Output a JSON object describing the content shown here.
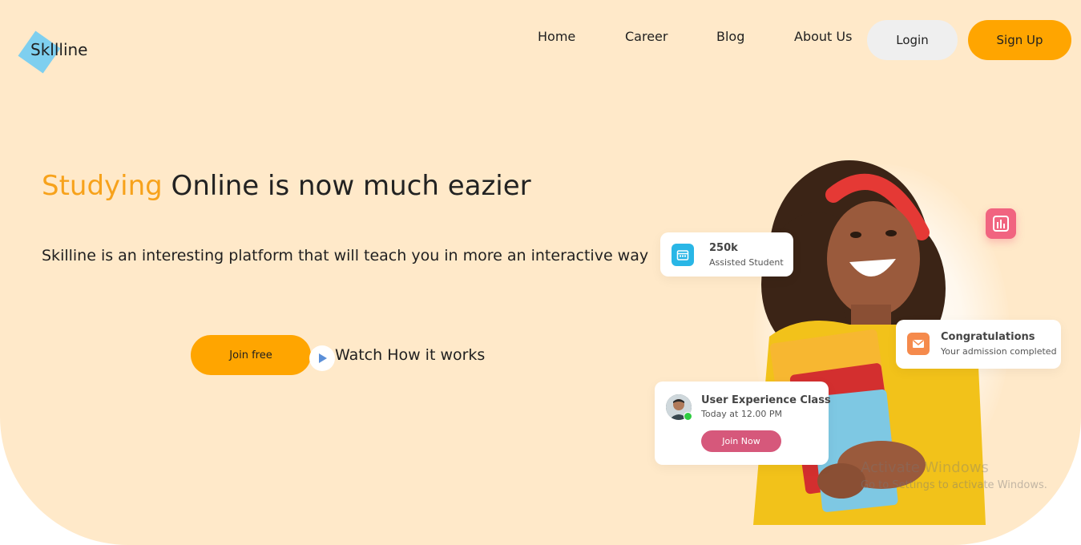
{
  "brand": {
    "logo_text": "Skllline"
  },
  "nav": {
    "links": [
      "Home",
      "Career",
      "Blog",
      "About Us"
    ],
    "login_label": "Login",
    "signup_label": "Sign Up"
  },
  "hero": {
    "headline_accent": "Studying",
    "headline_rest": " Online is now much eazier",
    "subtitle": "Skilline is an interesting platform that will teach you in more an interactive way",
    "join_label": "Join free",
    "watch_label": "Watch How it works"
  },
  "cards": {
    "students": {
      "value": "250k",
      "label": "Assisted Student",
      "icon": "calendar-icon"
    },
    "admission": {
      "title": "Congratulations",
      "subtitle": "Your admission completed",
      "icon": "mail-icon"
    },
    "class": {
      "title": "User Experience Class",
      "time": "Today at 12.00 PM",
      "button": "Join Now"
    },
    "chart_badge": {
      "icon": "bar-chart-icon"
    }
  },
  "watermark": {
    "line1": "Activate Windows",
    "line2": "Go to Settings to activate Windows."
  },
  "colors": {
    "background": "#ffe9c9",
    "accent_orange": "#ffa500",
    "headline_accent": "#f7a21b",
    "pink": "#d6587b",
    "cyan": "#29b6e6"
  }
}
